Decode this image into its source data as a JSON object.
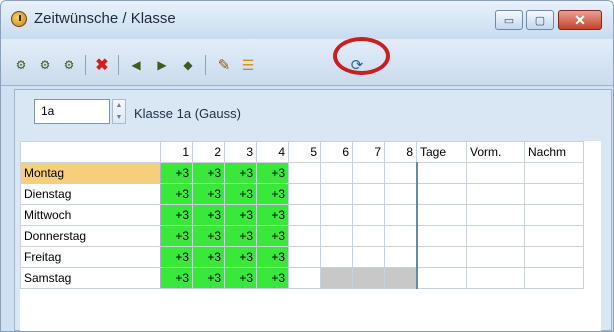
{
  "window": {
    "title": "Zeitwünsche / Klasse",
    "controls": {
      "minimize": "▭",
      "maximize": "▢",
      "close": "✕"
    }
  },
  "toolbar": {
    "icons": [
      {
        "name": "time-request-icon",
        "glyph": "⚙"
      },
      {
        "name": "time-request-2-icon",
        "glyph": "⚙"
      },
      {
        "name": "time-request-3-icon",
        "glyph": "⚙"
      },
      {
        "name": "delete-icon",
        "glyph": "✖"
      },
      {
        "name": "shift-left-icon",
        "glyph": "◀"
      },
      {
        "name": "shift-right-icon",
        "glyph": "▶"
      },
      {
        "name": "shift-all-icon",
        "glyph": "◆"
      },
      {
        "name": "edit-icon",
        "glyph": "✎"
      },
      {
        "name": "list-icon",
        "glyph": "☰"
      },
      {
        "name": "transfer-icon",
        "glyph": "⟳"
      }
    ],
    "highlight_color": "#c81f1f"
  },
  "selector": {
    "value": "1a",
    "label": "Klasse 1a (Gauss)"
  },
  "grid": {
    "headers": [
      "1",
      "2",
      "3",
      "4",
      "5",
      "6",
      "7",
      "8",
      "Tage",
      "Vorm.",
      "Nachm"
    ],
    "rows": [
      {
        "day": "Montag",
        "cells": [
          "+3",
          "+3",
          "+3",
          "+3",
          "",
          "",
          "",
          "",
          "",
          "",
          ""
        ]
      },
      {
        "day": "Dienstag",
        "cells": [
          "+3",
          "+3",
          "+3",
          "+3",
          "",
          "",
          "",
          "",
          "",
          "",
          ""
        ]
      },
      {
        "day": "Mittwoch",
        "cells": [
          "+3",
          "+3",
          "+3",
          "+3",
          "",
          "",
          "",
          "",
          "",
          "",
          ""
        ]
      },
      {
        "day": "Donnerstag",
        "cells": [
          "+3",
          "+3",
          "+3",
          "+3",
          "",
          "",
          "",
          "",
          "",
          "",
          ""
        ]
      },
      {
        "day": "Freitag",
        "cells": [
          "+3",
          "+3",
          "+3",
          "+3",
          "",
          "",
          "",
          "",
          "",
          "",
          ""
        ]
      },
      {
        "day": "Samstag",
        "cells": [
          "+3",
          "+3",
          "+3",
          "+3",
          "",
          "",
          "",
          "",
          "",
          "",
          ""
        ]
      }
    ],
    "selected_row": "Montag",
    "colors": {
      "positive": "#39e83a",
      "selected_day": "#f7cf7a",
      "unavailable": "#c8c8c8"
    }
  }
}
